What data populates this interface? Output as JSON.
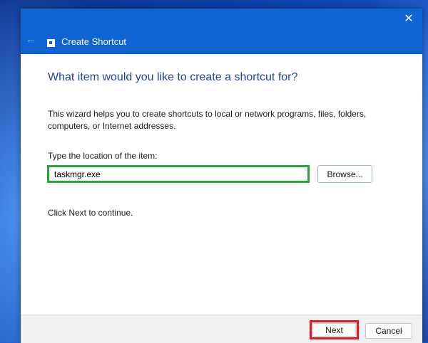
{
  "window": {
    "title": "Create Shortcut",
    "back_icon": "back-arrow-icon",
    "close_icon": "close-icon",
    "back_glyph": "←",
    "close_glyph": "✕"
  },
  "content": {
    "heading": "What item would you like to create a shortcut for?",
    "description": "This wizard helps you to create shortcuts to local or network programs, files, folders, computers, or Internet addresses.",
    "location_label": "Type the location of the item:",
    "location_value": "taskmgr.exe",
    "browse_label": "Browse...",
    "hint": "Click Next to continue."
  },
  "footer": {
    "next_label": "Next",
    "cancel_label": "Cancel"
  },
  "colors": {
    "titlebar": "#0e64d2",
    "heading": "#1a47a3",
    "input_highlight": "#29a538",
    "next_highlight": "#e01926"
  }
}
